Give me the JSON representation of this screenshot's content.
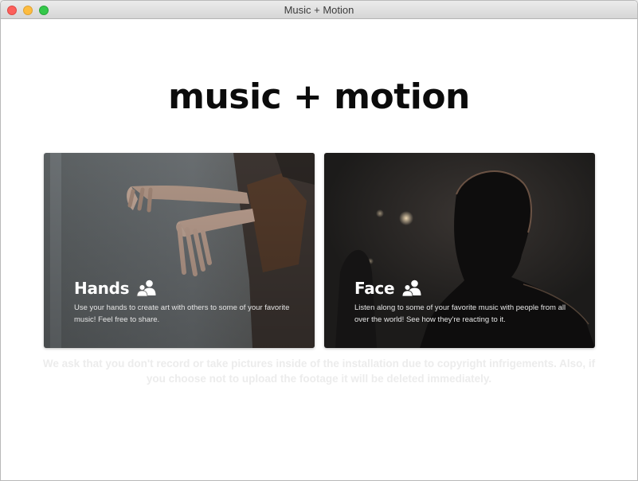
{
  "window": {
    "title": "Music + Motion"
  },
  "page": {
    "title": "music + motion"
  },
  "cards": [
    {
      "title": "Hands",
      "description": "Use your hands to create art with others to some of your favorite music! Feel free to share.",
      "icon": "people-icon"
    },
    {
      "title": "Face",
      "description": "Listen along to some of your favorite music with people from all over the world! See how they're reacting to it.",
      "icon": "people-icon"
    }
  ],
  "notice": "We ask that you don't record or take pictures inside of the installation due to copyright infrigements. Also, if you choose not to upload the footage it will be deleted immediately.",
  "colors": {
    "title_text": "#0b0b0b",
    "card_text": "#ffffff",
    "notice_text": "#ececec",
    "close": "#fc605c",
    "minimize": "#fdbc40",
    "maximize": "#34c84a"
  }
}
